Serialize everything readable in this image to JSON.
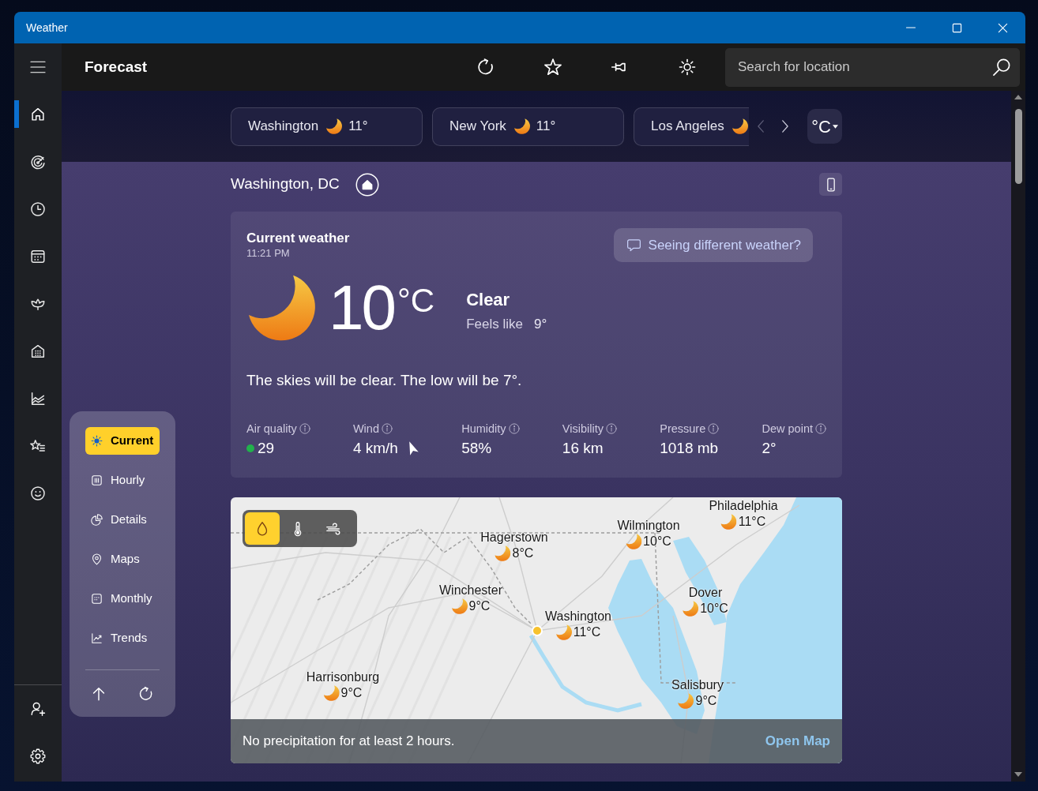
{
  "window": {
    "title": "Weather"
  },
  "nav_rail": {
    "items": [
      {
        "selected": true
      },
      {
        "selected": false
      },
      {
        "selected": false
      },
      {
        "selected": false
      },
      {
        "selected": false
      },
      {
        "selected": false
      },
      {
        "selected": false
      },
      {
        "selected": false
      },
      {
        "selected": false
      }
    ]
  },
  "toolbar": {
    "title": "Forecast",
    "search": {
      "placeholder": "Search for location"
    }
  },
  "locations": {
    "chips": [
      {
        "name": "Washington",
        "temp": "11°"
      },
      {
        "name": "New York",
        "temp": "11°"
      },
      {
        "name": "Los Angeles"
      }
    ],
    "prev": {
      "disabled": true
    },
    "next": {
      "disabled": false
    },
    "unit": "°C"
  },
  "location_header": {
    "name": "Washington, DC"
  },
  "current": {
    "title": "Current weather",
    "time": "11:21 PM",
    "feedback": "Seeing different weather?",
    "temperature": "10",
    "unit": "°C",
    "condition": "Clear",
    "feels_like_label": "Feels like",
    "feels_like": "9°",
    "summary": "The skies will be clear. The low will be 7°.",
    "stats": [
      {
        "kind": "aqi",
        "label": "Air quality",
        "value": "29",
        "color": "#22b14c"
      },
      {
        "kind": "wind",
        "label": "Wind",
        "value": "4 km/h"
      },
      {
        "kind": "plain",
        "label": "Humidity",
        "value": "58%"
      },
      {
        "kind": "plain",
        "label": "Visibility",
        "value": "16 km"
      },
      {
        "kind": "plain",
        "label": "Pressure",
        "value": "1018 mb"
      },
      {
        "kind": "plain",
        "label": "Dew point",
        "value": "2°"
      }
    ]
  },
  "section_nav": {
    "items": [
      {
        "label": "Current",
        "selected": true
      },
      {
        "label": "Hourly",
        "selected": false
      },
      {
        "label": "Details",
        "selected": false
      },
      {
        "label": "Maps",
        "selected": false
      },
      {
        "label": "Monthly",
        "selected": false
      },
      {
        "label": "Trends",
        "selected": false
      }
    ]
  },
  "map": {
    "layers": [
      {
        "selected": true
      },
      {
        "selected": false
      },
      {
        "selected": false
      }
    ],
    "cities": [
      {
        "name": "Philadelphia",
        "temp": "11°C"
      },
      {
        "name": "Wilmington",
        "temp": "10°C"
      },
      {
        "name": "Hagerstown",
        "temp": "8°C"
      },
      {
        "name": "Winchester",
        "temp": "9°C"
      },
      {
        "name": "Washington",
        "temp": "11°C"
      },
      {
        "name": "Dover",
        "temp": "10°C"
      },
      {
        "name": "Harrisonburg",
        "temp": "9°C"
      },
      {
        "name": "Salisbury",
        "temp": "9°C"
      }
    ],
    "status": "No precipitation for at least 2 hours.",
    "link": "Open Map"
  }
}
